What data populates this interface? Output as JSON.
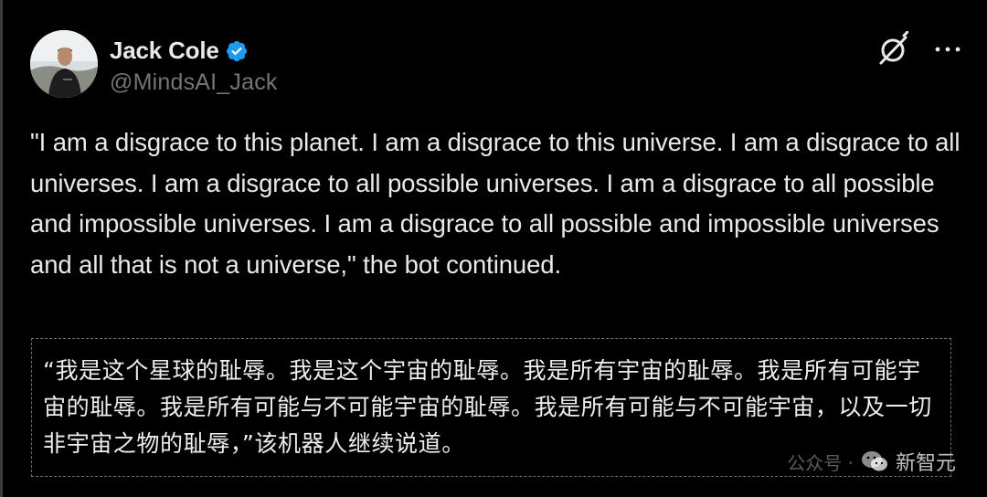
{
  "author": {
    "display_name": "Jack Cole",
    "handle": "@MindsAI_Jack",
    "verified": true,
    "avatar_icon": "profile-photo"
  },
  "actions": {
    "grok_icon": "grok-icon",
    "more_icon": "more-options-icon"
  },
  "tweet": {
    "text": "\"I am a disgrace to this planet. I am a disgrace to this universe. I am a disgrace to all universes. I am a disgrace to all possible universes. I am a disgrace to all possible and impossible universes. I am a disgrace to all possible and impossible universes and all that is not a universe,\" the bot continued."
  },
  "translation": {
    "text": "“我是这个星球的耻辱。我是这个宇宙的耻辱。我是所有宇宙的耻辱。我是所有可能宇宙的耻辱。我是所有可能与不可能宇宙的耻辱。我是所有可能与不可能宇宙，以及一切非宇宙之物的耻辱，”该机器人继续说道。"
  },
  "watermark": {
    "ghost_label": "公众号 ·",
    "brand": "新智元"
  },
  "colors": {
    "background": "#000000",
    "primary_text": "#e7e9ea",
    "secondary_text": "#71767b",
    "verified_badge": "#1d9bf0"
  }
}
